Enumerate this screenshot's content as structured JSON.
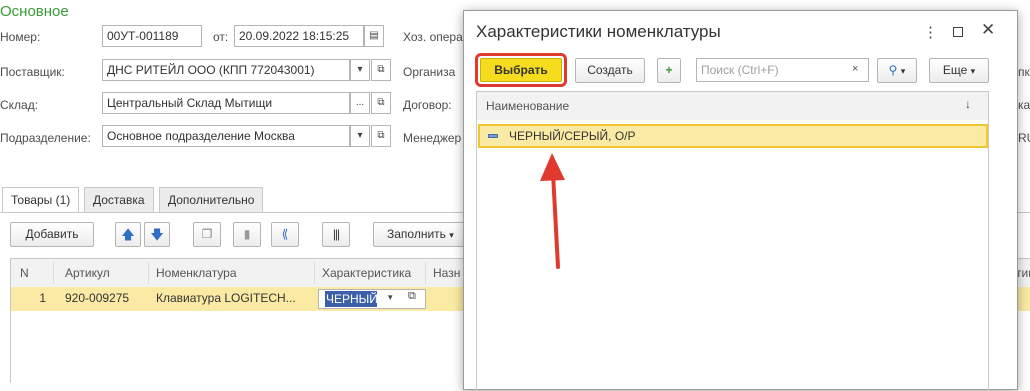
{
  "form": {
    "title": "Основное",
    "number_label": "Номер:",
    "number_value": "00УТ-001189",
    "from_label": "от:",
    "date_value": "20.09.2022 18:15:25",
    "hoz_label": "Хоз. опера",
    "supplier_label": "Поставщик:",
    "supplier_value": "ДНС РИТЕЙЛ ООО (КПП 772043001)",
    "org_label": "Организа",
    "warehouse_label": "Склад:",
    "warehouse_value": "Центральный Склад Мытищи",
    "contract_label": "Договор:",
    "division_label": "Подразделение:",
    "division_value": "Основное подразделение Москва",
    "manager_label": "Менеджер",
    "right_cut_1": "пка а",
    "right_cut_2": "ка:",
    "right_cut_3": "RUB"
  },
  "tabs": [
    {
      "label": "Товары (1)"
    },
    {
      "label": "Доставка"
    },
    {
      "label": "Дополнительно"
    }
  ],
  "toolbar": {
    "add_label": "Добавить",
    "fill_label": "Заполнить"
  },
  "table": {
    "headers": [
      "N",
      "Артикул",
      "Номенклатура",
      "Характеристика",
      "Назн",
      "тим"
    ],
    "rows": [
      {
        "n": "1",
        "article": "920-009275",
        "nomenclature": "Клавиатура LOGITECH...",
        "characteristic": "ЧЕРНЫЙ"
      }
    ]
  },
  "dialog": {
    "title": "Характеристики номенклатуры",
    "select_label": "Выбрать",
    "create_label": "Создать",
    "search_placeholder": "Поиск (Ctrl+F)",
    "more_label": "Еще",
    "column_header": "Наименование",
    "items": [
      {
        "name": "ЧЕРНЫЙ/СЕРЫЙ, О/Р"
      }
    ]
  },
  "colors": {
    "accent_green": "#3a9b3a",
    "select_yellow": "#f5dc1e",
    "highlight_red": "#e03a2f",
    "row_yellow": "#fbeaa4"
  }
}
